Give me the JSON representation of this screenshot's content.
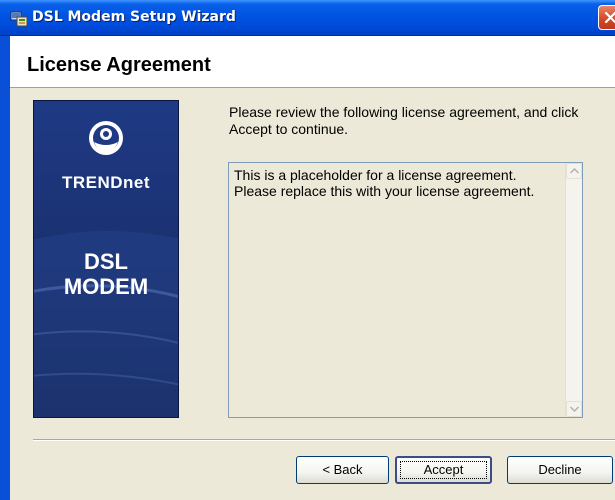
{
  "window": {
    "title": "DSL Modem Setup Wizard"
  },
  "header": {
    "title": "License Agreement"
  },
  "banner": {
    "brand": "TRENDnet",
    "product_line1": "DSL",
    "product_line2": "MODEM"
  },
  "instruction": "Please review the following license agreement, and click Accept to continue.",
  "license": {
    "text": "This is a placeholder for a license agreement.  Please replace this with your license agreement."
  },
  "buttons": {
    "back": "< Back",
    "accept": "Accept",
    "decline": "Decline"
  },
  "icons": {
    "app": "setup-wizard-icon",
    "close": "close-icon",
    "logo": "trendnet-logo-icon",
    "scroll_up": "arrow-up-icon",
    "scroll_down": "arrow-down-icon"
  },
  "colors": {
    "titlebar": "#0054e3",
    "dialog_bg": "#ece9d8",
    "banner_bg": "#1a2f6e",
    "close_button": "#d44a2a"
  }
}
